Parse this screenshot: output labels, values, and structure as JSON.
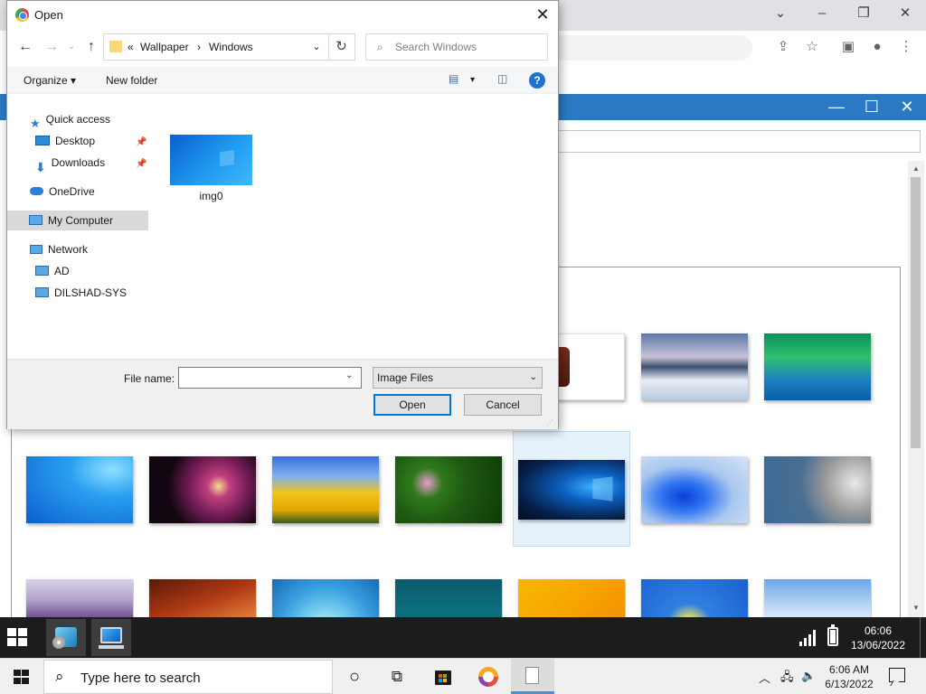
{
  "dialog": {
    "title": "Open",
    "breadcrumb": {
      "overflow": "«",
      "parent": "Wallpaper",
      "separator": "›",
      "current": "Windows"
    },
    "search_placeholder": "Search Windows",
    "toolbar": {
      "organize": "Organize ▾",
      "new_folder": "New folder",
      "view_dropdown": "▾",
      "help": "?"
    },
    "nav": {
      "quick_access": "Quick access",
      "desktop": "Desktop",
      "downloads": "Downloads",
      "onedrive": "OneDrive",
      "my_computer": "My Computer",
      "network": "Network",
      "ad": "AD",
      "dilshad_sys": "DILSHAD-SYS",
      "selected": "My Computer"
    },
    "files": [
      {
        "name": "img0"
      }
    ],
    "footer": {
      "file_name_label": "File name:",
      "file_name_value": "",
      "file_type": "Image Files",
      "open_button": "Open",
      "cancel_button": "Cancel"
    }
  },
  "vm_taskbar": {
    "time": "06:06",
    "date": "13/06/2022"
  },
  "host_taskbar": {
    "search_text": "Type here to search",
    "time": "6:06 AM",
    "date": "6/13/2022"
  },
  "colors": {
    "app_titlebar": "#2b79c2",
    "accent": "#0078d7",
    "vm_taskbar": "#1c1c1c",
    "host_taskbar": "#f0f0f0",
    "selection": "#e5f1fb"
  },
  "icons": {
    "window_controls": [
      "chevron-down-icon",
      "minimize-icon",
      "restore-icon",
      "close-icon"
    ],
    "browser_toolbar": [
      "share-icon",
      "star-icon",
      "side-panel-icon",
      "profile-icon",
      "menu-icon"
    ],
    "dialog_nav": [
      "back-icon",
      "forward-icon",
      "up-icon",
      "refresh-icon",
      "search-icon"
    ],
    "host_tray": [
      "chevron-up-icon",
      "network-icon",
      "volume-icon",
      "notification-icon"
    ]
  }
}
